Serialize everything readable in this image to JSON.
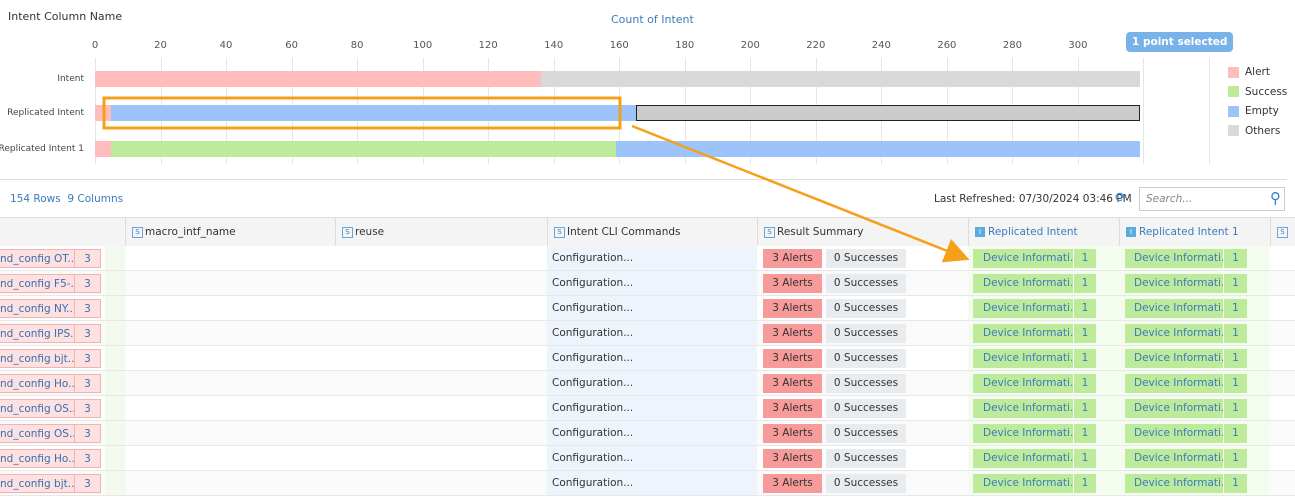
{
  "chart_data": {
    "type": "bar",
    "stacked": true,
    "orientation": "horizontal",
    "ylabel": "Intent Column Name",
    "xlabel": "Count of Intent",
    "xlim": [
      0,
      340
    ],
    "xticks": [
      0,
      20,
      40,
      60,
      80,
      100,
      120,
      140,
      160,
      180,
      200,
      220,
      240,
      260,
      280,
      300,
      320,
      340
    ],
    "categories": [
      "Intent",
      "Replicated Intent",
      "Replicated Intent 1"
    ],
    "series": [
      {
        "name": "Alert",
        "color": "#ffbcbc",
        "values": [
          136,
          5,
          5
        ]
      },
      {
        "name": "Success",
        "color": "#bdeb9b",
        "values": [
          0,
          0,
          154
        ]
      },
      {
        "name": "Empty",
        "color": "#9cc3fa",
        "values": [
          0,
          160,
          160
        ]
      },
      {
        "name": "Others",
        "color": "#d9d9d9",
        "values": [
          183,
          154,
          0
        ]
      }
    ],
    "selected": {
      "category": "Replicated Intent",
      "series": "Others"
    },
    "legend": "right"
  },
  "selection_tip": "1 point selected",
  "toolbar": {
    "rows": "154 Rows",
    "columns": "9 Columns",
    "refreshed": "Last Refreshed: 07/30/2024 03:46 PM",
    "search_placeholder": "Search..."
  },
  "columns": [
    {
      "label": "macro_intf_name",
      "type": "S"
    },
    {
      "label": "reuse",
      "type": "S"
    },
    {
      "label": "Intent CLI Commands",
      "type": "S"
    },
    {
      "label": "Result Summary",
      "type": "S"
    },
    {
      "label": "Replicated Intent",
      "type": "I"
    },
    {
      "label": "Replicated Intent 1",
      "type": "I"
    },
    {
      "label": "",
      "type": "S"
    }
  ],
  "rows": [
    {
      "name": "nd_config OT...",
      "count": "3",
      "cli": "Configuration...",
      "alerts": "3 Alerts",
      "succ": "0 Successes",
      "ri": "Device Informati...",
      "ri_n": "1",
      "ri1": "Device Informati...",
      "ri1_n": "1"
    },
    {
      "name": "nd_config F5-...",
      "count": "3",
      "cli": "Configuration...",
      "alerts": "3 Alerts",
      "succ": "0 Successes",
      "ri": "Device Informati...",
      "ri_n": "1",
      "ri1": "Device Informati...",
      "ri1_n": "1"
    },
    {
      "name": "nd_config NY...",
      "count": "3",
      "cli": "Configuration...",
      "alerts": "3 Alerts",
      "succ": "0 Successes",
      "ri": "Device Informati...",
      "ri_n": "1",
      "ri1": "Device Informati...",
      "ri1_n": "1"
    },
    {
      "name": "nd_config IPS...",
      "count": "3",
      "cli": "Configuration...",
      "alerts": "3 Alerts",
      "succ": "0 Successes",
      "ri": "Device Informati...",
      "ri_n": "1",
      "ri1": "Device Informati...",
      "ri1_n": "1"
    },
    {
      "name": "nd_config bjt...",
      "count": "3",
      "cli": "Configuration...",
      "alerts": "3 Alerts",
      "succ": "0 Successes",
      "ri": "Device Informati...",
      "ri_n": "1",
      "ri1": "Device Informati...",
      "ri1_n": "1"
    },
    {
      "name": "nd_config Ho...",
      "count": "3",
      "cli": "Configuration...",
      "alerts": "3 Alerts",
      "succ": "0 Successes",
      "ri": "Device Informati...",
      "ri_n": "1",
      "ri1": "Device Informati...",
      "ri1_n": "1"
    },
    {
      "name": "nd_config OS...",
      "count": "3",
      "cli": "Configuration...",
      "alerts": "3 Alerts",
      "succ": "0 Successes",
      "ri": "Device Informati...",
      "ri_n": "1",
      "ri1": "Device Informati...",
      "ri1_n": "1"
    },
    {
      "name": "nd_config OS...",
      "count": "3",
      "cli": "Configuration...",
      "alerts": "3 Alerts",
      "succ": "0 Successes",
      "ri": "Device Informati...",
      "ri_n": "1",
      "ri1": "Device Informati...",
      "ri1_n": "1"
    },
    {
      "name": "nd_config Ho...",
      "count": "3",
      "cli": "Configuration...",
      "alerts": "3 Alerts",
      "succ": "0 Successes",
      "ri": "Device Informati...",
      "ri_n": "1",
      "ri1": "Device Informati...",
      "ri1_n": "1"
    },
    {
      "name": "nd_config bjt...",
      "count": "3",
      "cli": "Configuration...",
      "alerts": "3 Alerts",
      "succ": "0 Successes",
      "ri": "Device Informati...",
      "ri_n": "1",
      "ri1": "Device Informati...",
      "ri1_n": "1"
    }
  ]
}
